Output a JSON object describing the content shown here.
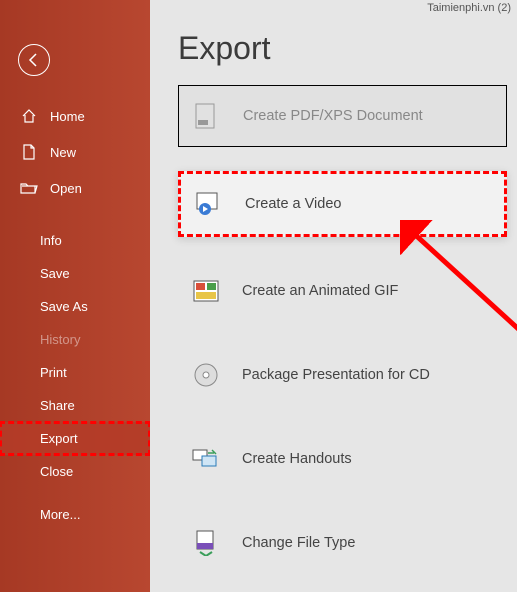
{
  "titlebar": {
    "text": "Taimienphi.vn (2)"
  },
  "page": {
    "title": "Export"
  },
  "sidebar": {
    "primary": [
      {
        "label": "Home"
      },
      {
        "label": "New"
      },
      {
        "label": "Open"
      }
    ],
    "secondary": [
      {
        "label": "Info"
      },
      {
        "label": "Save"
      },
      {
        "label": "Save As"
      },
      {
        "label": "History",
        "disabled": true
      },
      {
        "label": "Print"
      },
      {
        "label": "Share"
      },
      {
        "label": "Export",
        "selected": true
      },
      {
        "label": "Close"
      },
      {
        "label": "More..."
      }
    ]
  },
  "export_options": [
    {
      "label": "Create PDF/XPS Document",
      "icon": "pdf-xps",
      "first": true
    },
    {
      "label": "Create a Video",
      "icon": "video",
      "highlight": true
    },
    {
      "label": "Create an Animated GIF",
      "icon": "gif"
    },
    {
      "label": "Package Presentation for CD",
      "icon": "cd"
    },
    {
      "label": "Create Handouts",
      "icon": "handouts"
    },
    {
      "label": "Change File Type",
      "icon": "file-type"
    }
  ]
}
